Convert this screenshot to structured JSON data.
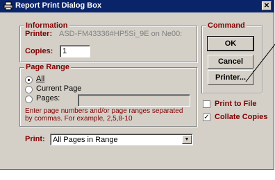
{
  "window": {
    "title": "Report Print Dialog Box",
    "close_label": "✕"
  },
  "information": {
    "legend": "Information",
    "printer_label": "Printer:",
    "printer_value": "ASD-FM43336#HP5Si_9E on Ne00:",
    "copies_label": "Copies:",
    "copies_value": "1"
  },
  "page_range": {
    "legend": "Page Range",
    "options": [
      {
        "label": "All",
        "selected": true
      },
      {
        "label": "Current Page",
        "selected": false
      },
      {
        "label": "Pages:",
        "selected": false
      }
    ],
    "pages_value": "",
    "hint": "Enter page numbers and/or page ranges separated by commas. For example, 2,5,8-10"
  },
  "print": {
    "label": "Print:",
    "value": "All Pages in Range"
  },
  "command": {
    "legend": "Command",
    "ok_label": "OK",
    "cancel_label": "Cancel",
    "printer_label": "Printer..."
  },
  "options": {
    "print_to_file": {
      "label": "Print to File",
      "checked": false
    },
    "collate_copies": {
      "label": "Collate Copies",
      "checked": true
    }
  }
}
